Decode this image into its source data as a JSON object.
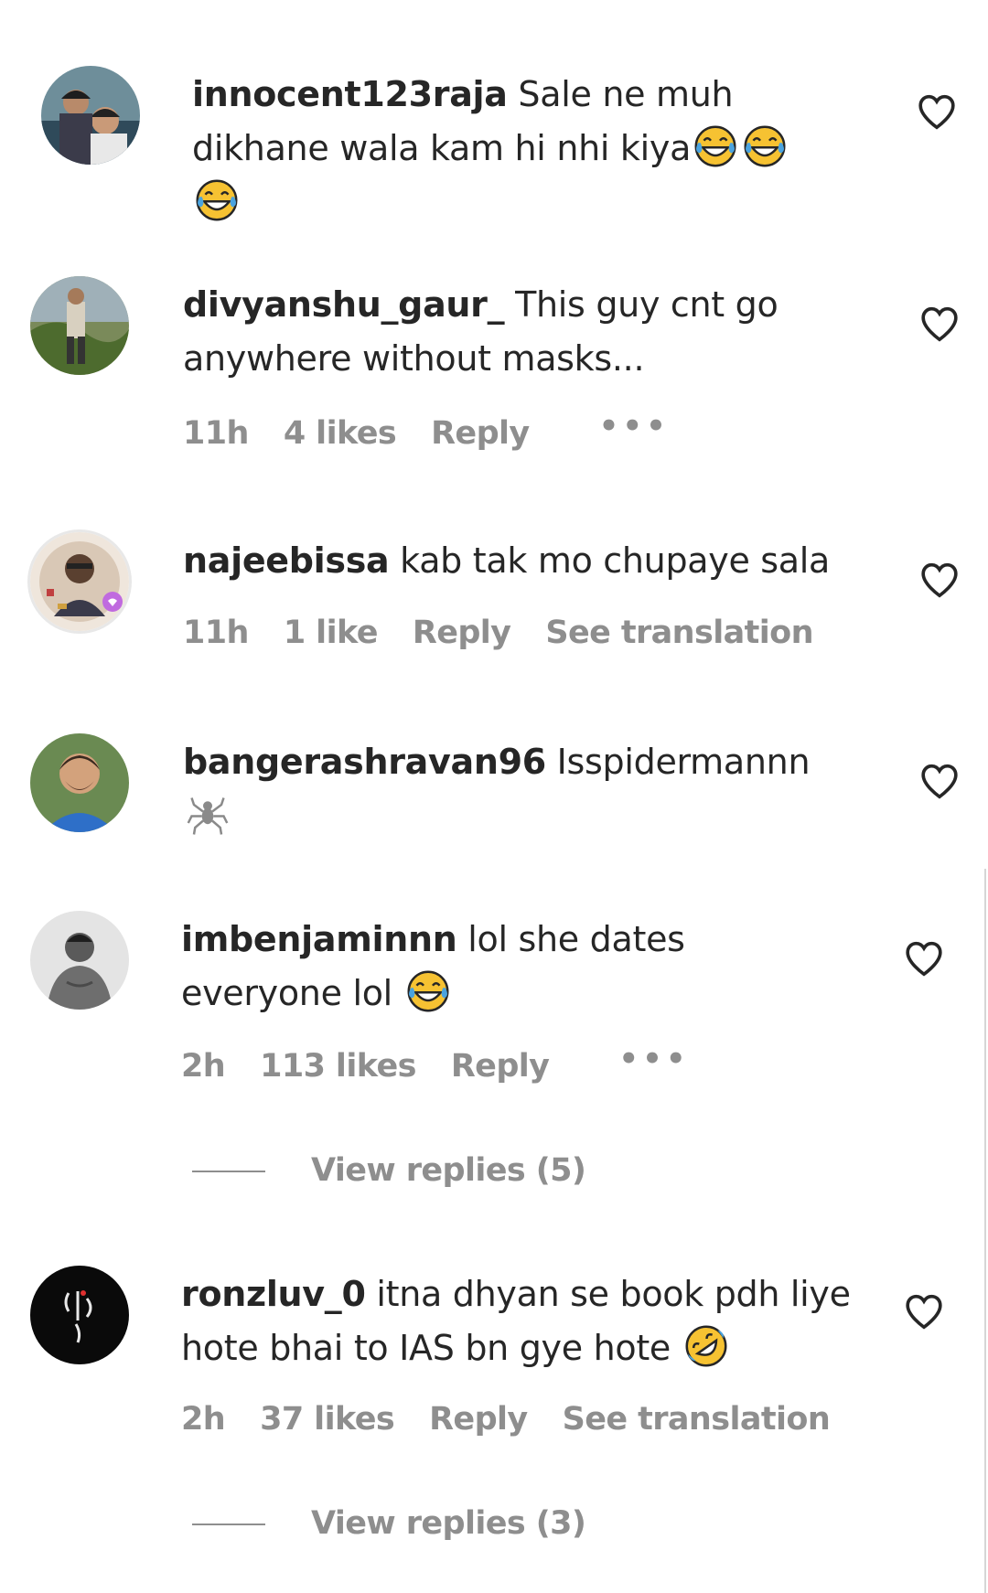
{
  "comments": [
    {
      "username": "innocent123raja",
      "text": " Sale ne muh dikhane wala kam hi nhi kiya",
      "emojis": [
        "😂",
        "😂",
        "😂"
      ],
      "icon": "heart-outline-icon"
    },
    {
      "username": "divyanshu_gaur_",
      "text": " This guy cnt go anywhere without masks...",
      "time": "11h",
      "likes": "4 likes",
      "reply": "Reply",
      "more": "•••",
      "icon": "heart-outline-icon"
    },
    {
      "username": "najeebissa",
      "text": " kab tak mo chupaye sala",
      "time": "11h",
      "likes": "1 like",
      "reply": "Reply",
      "see_translation": "See translation",
      "icon": "heart-outline-icon"
    },
    {
      "username": "bangerashravan96",
      "text": " Isspidermannn",
      "emojis": [
        "🕷"
      ],
      "icon": "heart-outline-icon"
    },
    {
      "username": "imbenjaminnn",
      "text": " lol she dates everyone lol ",
      "emojis": [
        "😂"
      ],
      "time": "2h",
      "likes": "113 likes",
      "reply": "Reply",
      "more": "•••",
      "view_replies": "View replies (5)",
      "icon": "heart-outline-icon"
    },
    {
      "username": "ronzluv_0",
      "text": " itna dhyan se book pdh liye hote bhai to IAS bn gye hote ",
      "emojis": [
        "🤣"
      ],
      "time": "2h",
      "likes": "37 likes",
      "reply": "Reply",
      "see_translation": "See translation",
      "view_replies": "View replies (3)",
      "icon": "heart-outline-icon"
    }
  ],
  "colors": {
    "text": "#262626",
    "secondary": "#8e8e8e",
    "emoji_yellow": "#f6c232",
    "tears_blue": "#4aa3df"
  }
}
